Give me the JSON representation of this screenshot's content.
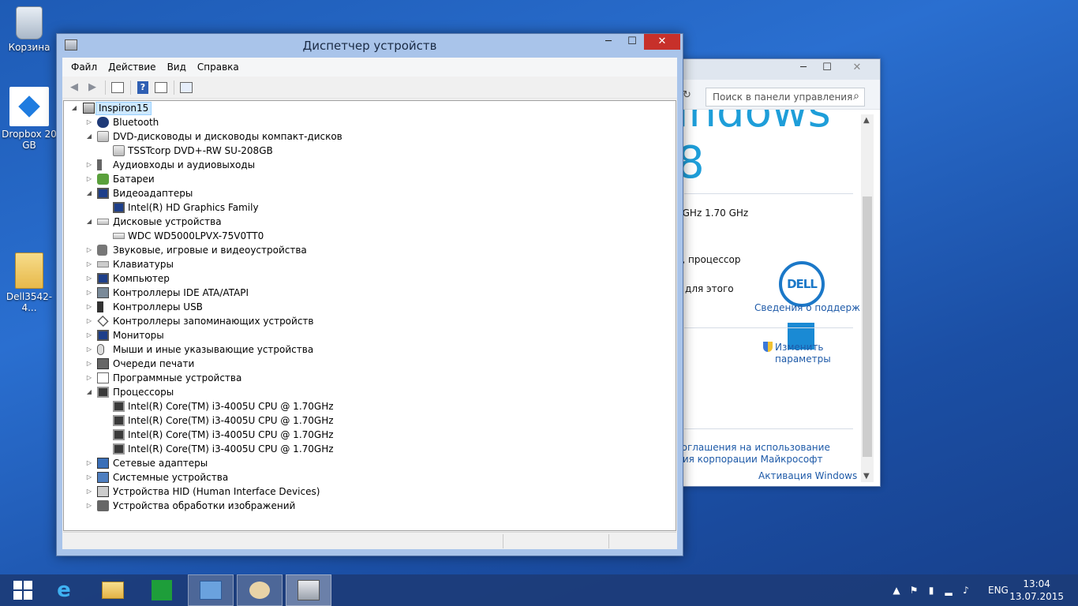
{
  "desktop": {
    "icons": [
      {
        "label": "Корзина"
      },
      {
        "label": "Dropbox 20 GB"
      },
      {
        "label": "Dell3542-4..."
      }
    ]
  },
  "control_panel": {
    "search_placeholder": "Поиск в панели управления",
    "partial_heading": "indows 8",
    "cpu_speed": "0GHz   1.70 GHz",
    "processor_text": "а, процессор",
    "for_this_text": "я для этого",
    "support_link": "Сведения о поддержке",
    "change_params_line1": "Изменить",
    "change_params_line2": "параметры",
    "license_line1": "соглашения на использование",
    "license_line2": "ния корпорации Майкрософт",
    "activation_link": "Активация Windows",
    "dell_logo_text": "DELL"
  },
  "device_manager": {
    "title": "Диспетчер устройств",
    "menu": [
      "Файл",
      "Действие",
      "Вид",
      "Справка"
    ],
    "tree": {
      "root": "Inspiron15",
      "nodes": [
        {
          "label": "Bluetooth",
          "expanded": false,
          "icon": "bluetooth-icon",
          "children": []
        },
        {
          "label": "DVD-дисководы и дисководы компакт-дисков",
          "expanded": true,
          "icon": "dvd-drive-icon",
          "children": [
            "TSSTcorp DVD+-RW SU-208GB"
          ]
        },
        {
          "label": "Аудиовходы и аудиовыходы",
          "expanded": false,
          "icon": "speaker-icon",
          "children": []
        },
        {
          "label": "Батареи",
          "expanded": false,
          "icon": "battery-icon",
          "children": []
        },
        {
          "label": "Видеоадаптеры",
          "expanded": true,
          "icon": "display-adapter-icon",
          "children": [
            "Intel(R) HD Graphics Family"
          ]
        },
        {
          "label": "Дисковые устройства",
          "expanded": true,
          "icon": "disk-drive-icon",
          "children": [
            "WDC WD5000LPVX-75V0TT0"
          ]
        },
        {
          "label": "Звуковые, игровые и видеоустройства",
          "expanded": false,
          "icon": "sound-video-icon",
          "children": []
        },
        {
          "label": "Клавиатуры",
          "expanded": false,
          "icon": "keyboard-icon",
          "children": []
        },
        {
          "label": "Компьютер",
          "expanded": false,
          "icon": "computer-icon",
          "children": []
        },
        {
          "label": "Контроллеры IDE ATA/ATAPI",
          "expanded": false,
          "icon": "ide-controller-icon",
          "children": []
        },
        {
          "label": "Контроллеры USB",
          "expanded": false,
          "icon": "usb-icon",
          "children": []
        },
        {
          "label": "Контроллеры запоминающих устройств",
          "expanded": false,
          "icon": "storage-controller-icon",
          "children": []
        },
        {
          "label": "Мониторы",
          "expanded": false,
          "icon": "monitor-icon",
          "children": []
        },
        {
          "label": "Мыши и иные указывающие устройства",
          "expanded": false,
          "icon": "mouse-icon",
          "children": []
        },
        {
          "label": "Очереди печати",
          "expanded": false,
          "icon": "printer-icon",
          "children": []
        },
        {
          "label": "Программные устройства",
          "expanded": false,
          "icon": "software-device-icon",
          "children": []
        },
        {
          "label": "Процессоры",
          "expanded": true,
          "icon": "processor-icon",
          "children": [
            "Intel(R) Core(TM) i3-4005U CPU @ 1.70GHz",
            "Intel(R) Core(TM) i3-4005U CPU @ 1.70GHz",
            "Intel(R) Core(TM) i3-4005U CPU @ 1.70GHz",
            "Intel(R) Core(TM) i3-4005U CPU @ 1.70GHz"
          ]
        },
        {
          "label": "Сетевые адаптеры",
          "expanded": false,
          "icon": "network-adapter-icon",
          "children": []
        },
        {
          "label": "Системные устройства",
          "expanded": false,
          "icon": "system-device-icon",
          "children": []
        },
        {
          "label": "Устройства HID (Human Interface Devices)",
          "expanded": false,
          "icon": "hid-icon",
          "children": []
        },
        {
          "label": "Устройства обработки изображений",
          "expanded": false,
          "icon": "imaging-device-icon",
          "children": []
        }
      ]
    }
  },
  "taskbar": {
    "apps": [
      "start",
      "internet-explorer",
      "file-explorer",
      "store",
      "control-panel",
      "paint",
      "device-manager"
    ],
    "active_app": "device-manager",
    "language": "ENG",
    "time": "13:04",
    "date": "13.07.2015"
  }
}
